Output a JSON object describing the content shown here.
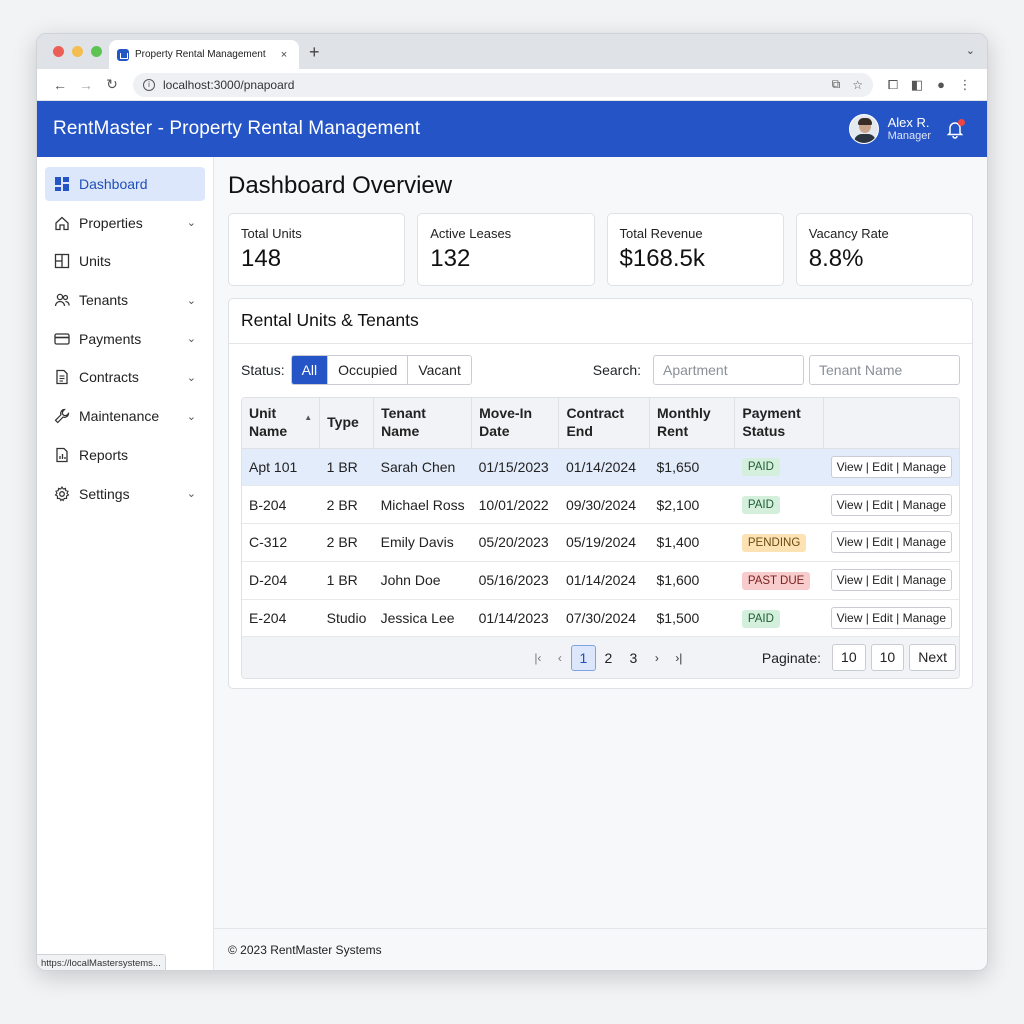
{
  "browser": {
    "tab_title": "Property Rental Management",
    "tab_close": "×",
    "new_tab": "+",
    "url": "localhost:3000/pnapoard",
    "status_url": "https://localMastersystems..."
  },
  "header": {
    "app_title": "RentMaster - Property Rental Management",
    "user_name": "Alex R.",
    "user_role": "Manager"
  },
  "sidebar": {
    "items": [
      {
        "label": "Dashboard",
        "icon": "dashboard-icon",
        "has_chevron": false
      },
      {
        "label": "Properties",
        "icon": "home-icon",
        "has_chevron": true
      },
      {
        "label": "Units",
        "icon": "units-icon",
        "has_chevron": false
      },
      {
        "label": "Tenants",
        "icon": "users-icon",
        "has_chevron": true
      },
      {
        "label": "Payments",
        "icon": "credit-card-icon",
        "has_chevron": true
      },
      {
        "label": "Contracts",
        "icon": "document-icon",
        "has_chevron": true
      },
      {
        "label": "Maintenance",
        "icon": "wrench-icon",
        "has_chevron": true
      },
      {
        "label": "Reports",
        "icon": "report-icon",
        "has_chevron": false
      },
      {
        "label": "Settings",
        "icon": "gear-icon",
        "has_chevron": true
      }
    ]
  },
  "main": {
    "page_title": "Dashboard Overview",
    "stats": [
      {
        "label": "Total Units",
        "value": "148"
      },
      {
        "label": "Active Leases",
        "value": "132"
      },
      {
        "label": "Total Revenue",
        "value": "$168.5k"
      },
      {
        "label": "Vacancy Rate",
        "value": "8.8%"
      }
    ],
    "panel_title": "Rental Units & Tenants",
    "status_label": "Status:",
    "status_options": [
      "All",
      "Occupied",
      "Vacant"
    ],
    "search_label": "Search:",
    "search_placeholders": [
      "Apartment",
      "Tenant Name"
    ],
    "table": {
      "columns": [
        "Unit Name",
        "Type",
        "Tenant Name",
        "Move-In Date",
        "Contract End",
        "Monthly Rent",
        "Payment Status",
        ""
      ],
      "rows": [
        [
          "Apt 101",
          "1 BR",
          "Sarah Chen",
          "01/15/2023",
          "01/14/2024",
          "$1,650",
          "PAID",
          "View | Edit | Manage"
        ],
        [
          "B-204",
          "2 BR",
          "Michael Ross",
          "10/01/2022",
          "09/30/2024",
          "$2,100",
          "PAID",
          "View | Edit | Manage"
        ],
        [
          "C-312",
          "2 BR",
          "Emily Davis",
          "05/20/2023",
          "05/19/2024",
          "$1,400",
          "PENDING",
          "View | Edit | Manage"
        ],
        [
          "D-204",
          "1 BR",
          "John Doe",
          "05/16/2023",
          "01/14/2024",
          "$1,600",
          "PAST DUE",
          "View | Edit | Manage"
        ],
        [
          "E-204",
          "Studio",
          "Jessica Lee",
          "01/14/2023",
          "07/30/2024",
          "$1,500",
          "PAID",
          "View | Edit | Manage"
        ]
      ]
    },
    "pagination": {
      "pages": [
        "1",
        "2",
        "3"
      ],
      "current": "1",
      "label": "Paginate:",
      "buttons": [
        "10",
        "10",
        "Next"
      ]
    },
    "footer": "© 2023 RentMaster Systems"
  },
  "colors": {
    "brand": "#2454c6",
    "paid": "#d4f0dc",
    "pending": "#fde3b4",
    "past_due": "#f8cccc"
  }
}
